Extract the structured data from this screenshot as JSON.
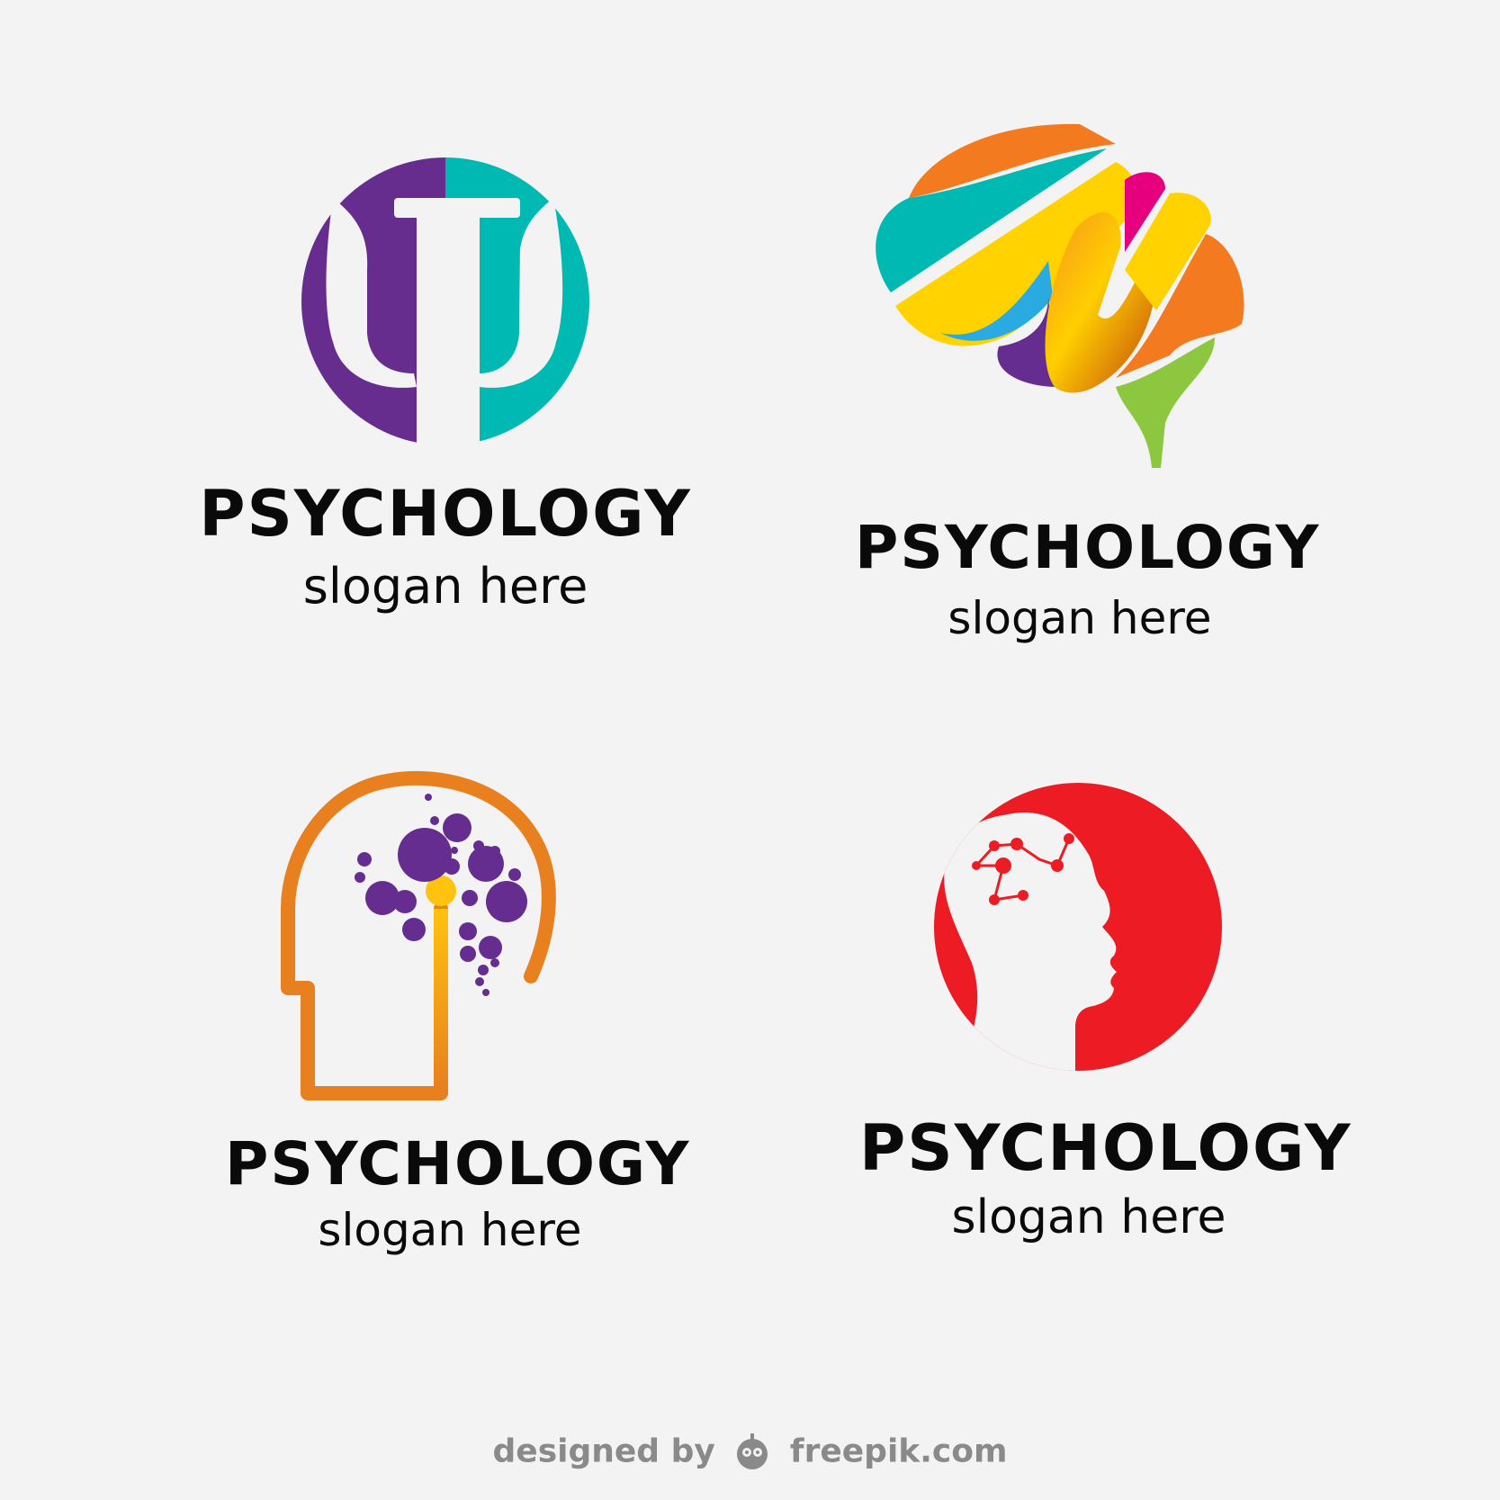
{
  "logos": [
    {
      "title": "PSYCHOLOGY",
      "slogan": "slogan here",
      "icon": "psi-symbol-icon",
      "colors": [
        "#662d8f",
        "#00b9b2"
      ]
    },
    {
      "title": "PSYCHOLOGY",
      "slogan": "slogan here",
      "icon": "colorful-brain-icon",
      "colors": [
        "#f47a20",
        "#00b9b2",
        "#ffd200",
        "#e6007e",
        "#29abe2",
        "#662d91",
        "#8dc63f"
      ]
    },
    {
      "title": "PSYCHOLOGY",
      "slogan": "slogan here",
      "icon": "head-profile-dots-icon",
      "colors": [
        "#e8801f",
        "#f7b500",
        "#662d91"
      ]
    },
    {
      "title": "PSYCHOLOGY",
      "slogan": "slogan here",
      "icon": "head-silhouette-network-icon",
      "colors": [
        "#ed1c24"
      ]
    }
  ],
  "credit": {
    "prefix": "designed by",
    "brand": "freepik.com"
  }
}
